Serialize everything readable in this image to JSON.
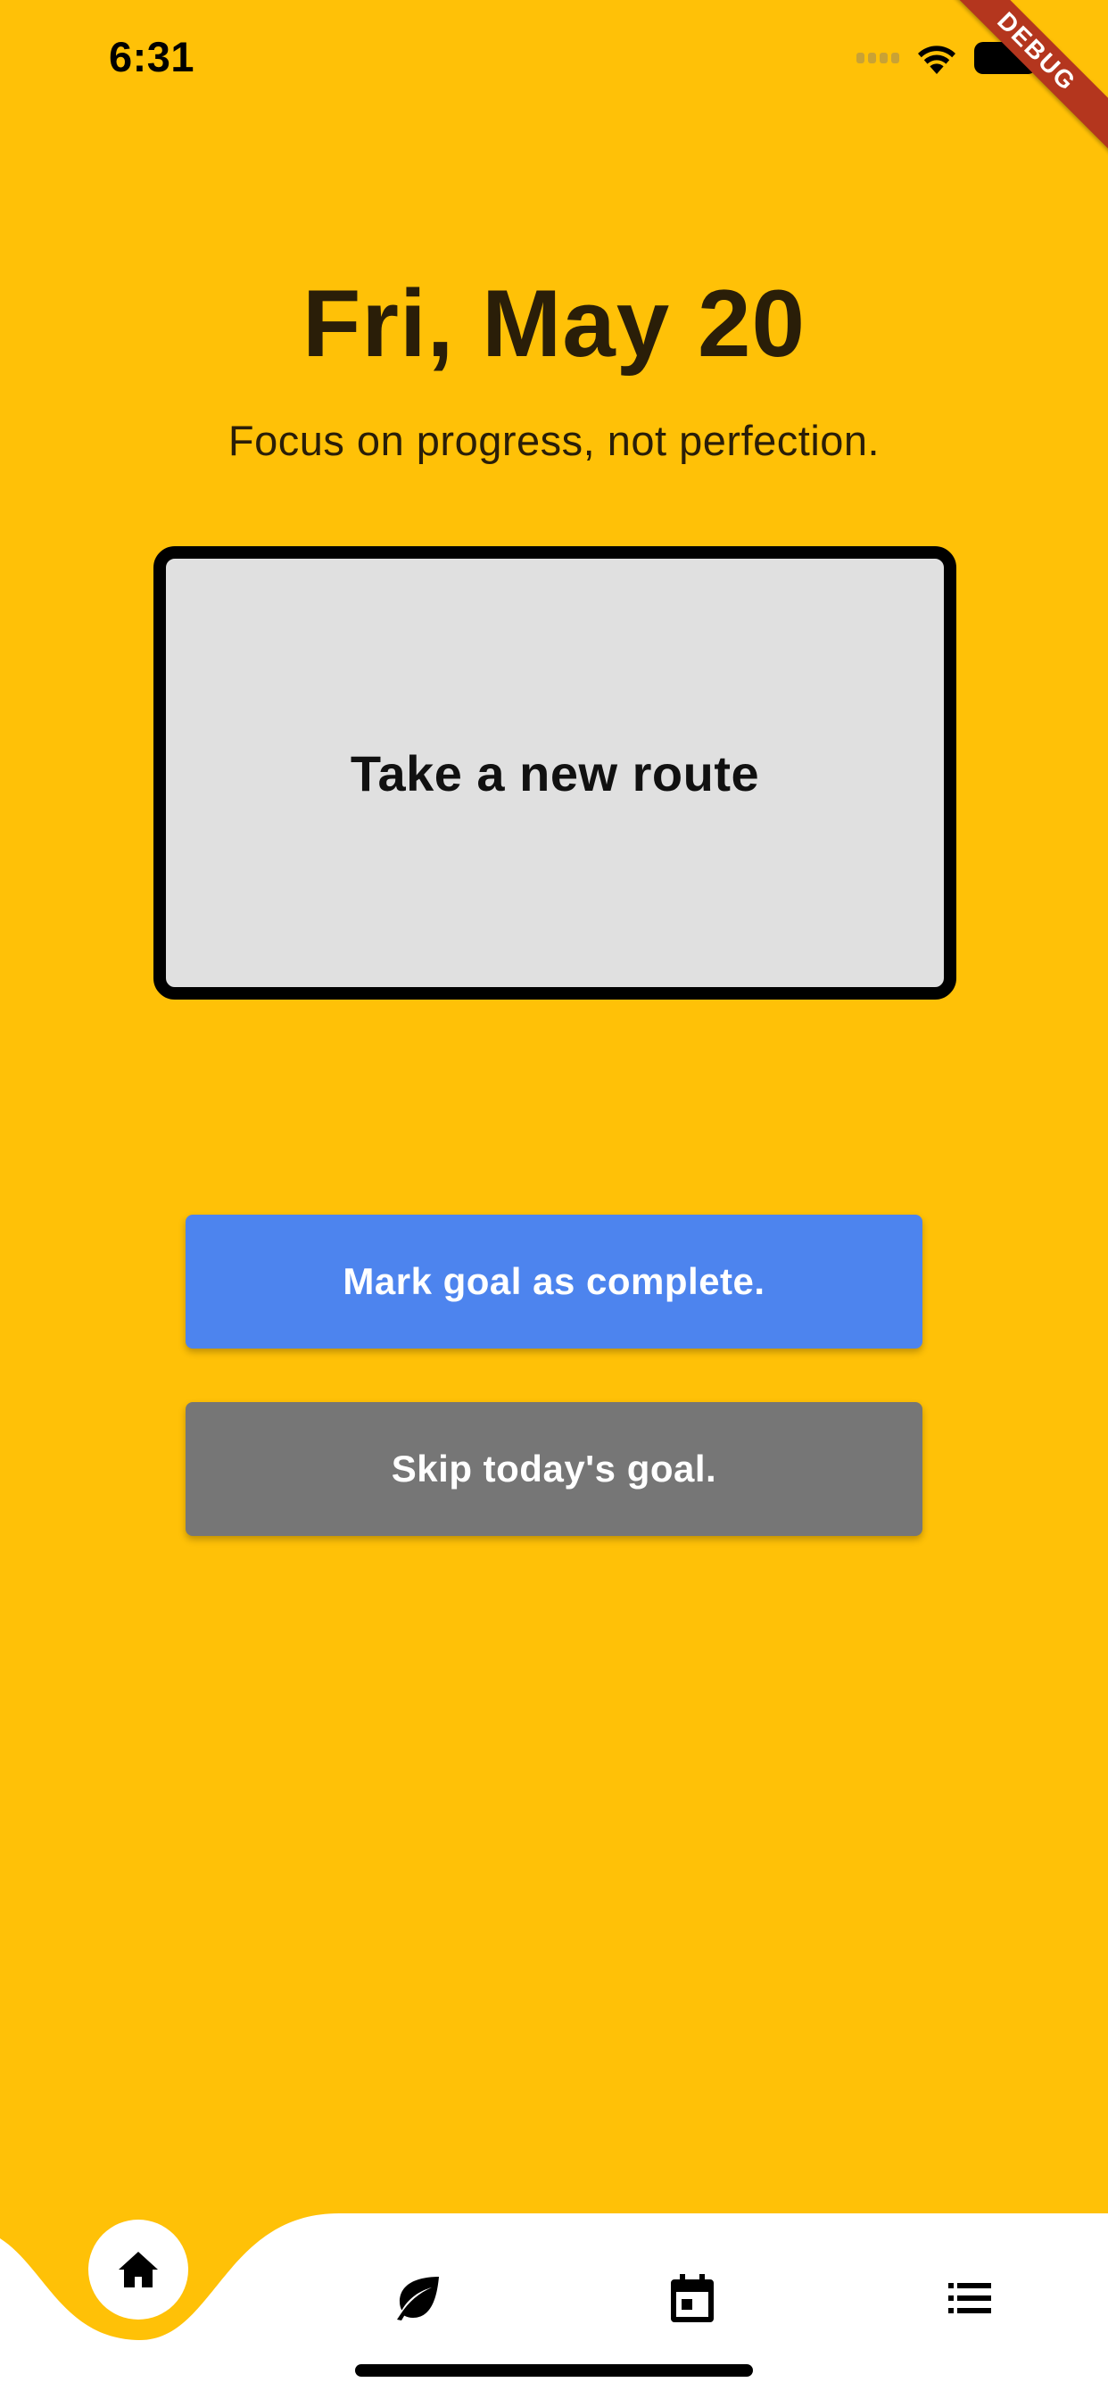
{
  "status_bar": {
    "time": "6:31",
    "icons": [
      "signal-icon",
      "wifi-icon",
      "battery-icon"
    ]
  },
  "debug_banner": {
    "label": "DEBUG"
  },
  "header": {
    "date": "Fri, May 20",
    "subtitle": "Focus on progress, not perfection."
  },
  "goal_card": {
    "text": "Take a new route"
  },
  "buttons": {
    "complete_label": "Mark goal as complete.",
    "skip_label": "Skip today's goal."
  },
  "bottom_nav": {
    "items": [
      {
        "icon": "home-icon",
        "active": true
      },
      {
        "icon": "leaf-icon",
        "active": false
      },
      {
        "icon": "calendar-icon",
        "active": false
      },
      {
        "icon": "list-icon",
        "active": false
      }
    ]
  },
  "colors": {
    "background": "#FFC107",
    "complete_button": "#4D84EE",
    "skip_button": "#767676",
    "card_background": "#E0E0E0",
    "debug_ribbon": "#B4361E"
  }
}
